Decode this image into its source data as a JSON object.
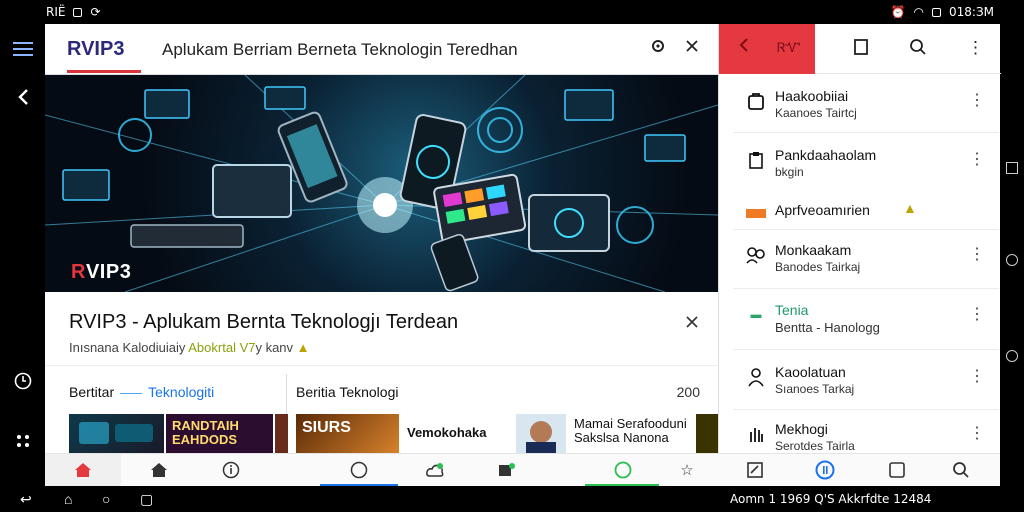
{
  "status_bar": {
    "left": "RІЁ",
    "right": "018:ЗМ"
  },
  "app": {
    "logo": "RVIP3",
    "title": "Aplukam  Berriam  Berneta  Teknologin  Teredhan",
    "location_icon": "location-icon",
    "close_icon": "close-icon"
  },
  "hero": {
    "watermark_prefix": "R",
    "watermark_rest": "VIP3"
  },
  "article": {
    "headline": "RVIP3 - Aplukam Bernta Teknologjı Terdean",
    "subline_gray": "Inısnana Kalodiuiaiy ",
    "subline_green": "Abokrtal V7",
    "subline_tail": "y kanv",
    "section_left": "Bertitar",
    "section_left_link": "Teknologiti",
    "section_middle": "Beritia  Teknologi",
    "section_count": "200",
    "thumbs": [
      {
        "title": "RANDTAIH EAHDODS"
      },
      {
        "title": "SIURS"
      },
      {
        "title": "Vemokohaka"
      },
      {
        "title": "Mamai Serafooduni Sakslsa Nanona"
      }
    ]
  },
  "right_panel": {
    "header_label": "ᏒᏉ",
    "rows": [
      {
        "title": "Haakoobiiai",
        "subtitle": "Kaanoes Tairtcj"
      },
      {
        "title": "Pankdaahaolam",
        "subtitle": "bkgin"
      },
      {
        "title": "Aprfveoamırien",
        "subtitle": ""
      },
      {
        "title": "Monkaakam",
        "subtitle": "Banodes Tairkaj"
      },
      {
        "title": "Tenia",
        "subtitle": "Bentta - Hanologg"
      },
      {
        "title": "Kaoolatuan",
        "subtitle": "Sıanoes Tarkaj"
      },
      {
        "title": "Mekhogi",
        "subtitle": "Serotdes Tairla"
      }
    ]
  },
  "system_nav": {
    "right_text": "Aomn  1 1969  Q'S  Akkrfdte 12484"
  },
  "colors": {
    "accent_red": "#e53942",
    "logo_blue": "#2b2a7a",
    "link_blue": "#1a73e8"
  }
}
